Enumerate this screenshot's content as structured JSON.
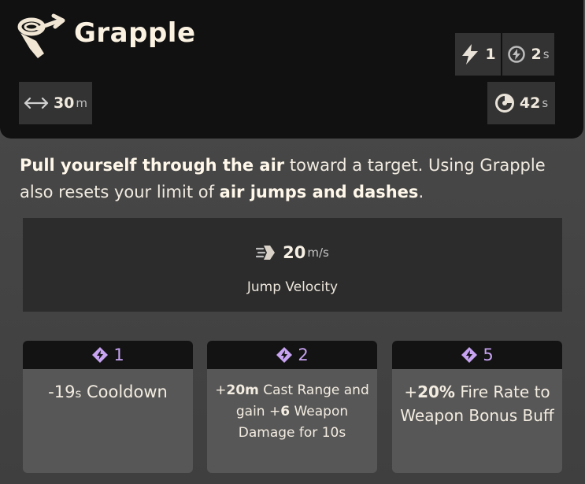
{
  "ability": {
    "title": "Grapple",
    "icon": "grapple-hook-icon"
  },
  "stats": {
    "range": {
      "value": "30",
      "unit": "m",
      "icon": "range-arrows-icon"
    },
    "charges": {
      "value": "1",
      "icon": "lightning-charge-icon"
    },
    "charge_cooldown": {
      "value": "2",
      "unit": "s",
      "icon": "charge-timer-icon"
    },
    "cooldown": {
      "value": "42",
      "unit": "s",
      "icon": "cooldown-clock-icon"
    }
  },
  "description": {
    "bold1": "Pull yourself through the air",
    "text1": " toward a target. Using Grapple also resets your limit of ",
    "bold2": "air jumps and dashes",
    "text2": "."
  },
  "velocity": {
    "value": "20",
    "unit": "m/s",
    "label": "Jump Velocity",
    "icon": "speed-dash-icon"
  },
  "upgrades": [
    {
      "tier": "1",
      "icon": "ability-point-icon",
      "prefix": "-19",
      "unit": "s",
      "suffix": " Cooldown"
    },
    {
      "tier": "2",
      "icon": "ability-point-icon",
      "plus1": "+",
      "num1": "20m",
      "text1": " Cast Range and gain ",
      "plus2": "+",
      "num2": "6",
      "text2": " Weapon Damage for 10s"
    },
    {
      "tier": "5",
      "icon": "ability-point-icon",
      "plus": "+",
      "num": "20%",
      "text": " Fire Rate to Weapon Bonus Buff"
    }
  ],
  "colors": {
    "header_bg": "#111111",
    "body_bg": "#434343",
    "tier_accent": "#c7a3f2",
    "text": "#f3ece1"
  }
}
